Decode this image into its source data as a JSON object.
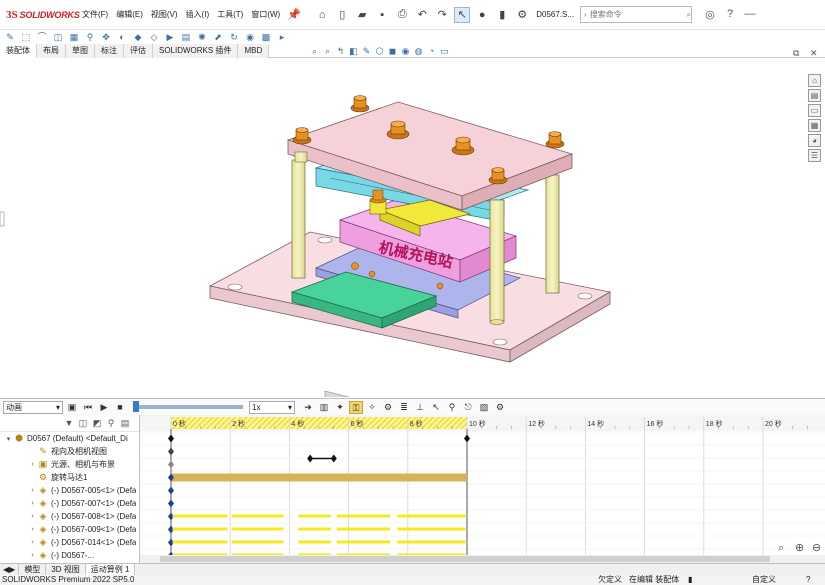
{
  "app": {
    "logo_ds": "3S",
    "logo_name": "SOLIDWORKS",
    "document": "D0567.S...",
    "search_placeholder": "搜索命令"
  },
  "menu": [
    "文件(F)",
    "编辑(E)",
    "视图(V)",
    "插入(I)",
    "工具(T)",
    "窗口(W)"
  ],
  "command_tabs": [
    "装配体",
    "布局",
    "草图",
    "标注",
    "评估",
    "SOLIDWORKS 插件",
    "MBD"
  ],
  "viewport": {
    "banner_text": "机械充电站",
    "colors": {
      "top_plate": "#f6d2d8",
      "base_plate": "#f8dde2",
      "posts": "#f3efb0",
      "cylinder": "#79d8e6",
      "block_pink": "#ef9fe0",
      "plate_purple": "#aeb5ec",
      "green_pad": "#47d39a",
      "yellow_part": "#f2e83a",
      "bolt": "#e59223"
    }
  },
  "motion": {
    "study_type": "动画",
    "speed": "1x",
    "time_labels": [
      "0 秒",
      "2 秒",
      "4 秒",
      "6 秒",
      "8 秒",
      "10 秒",
      "12 秒",
      "14 秒",
      "16 秒",
      "18 秒",
      "20 秒"
    ],
    "tree": [
      {
        "arrow": "▾",
        "indent": 0,
        "icon": "assembly-icon",
        "glyph": "⬢",
        "label": "D0567 (Default) <Default_Di"
      },
      {
        "arrow": "",
        "indent": 1,
        "icon": "camera-icon",
        "glyph": "✎",
        "label": "视向及相机视图"
      },
      {
        "arrow": "›",
        "indent": 1,
        "icon": "light-icon",
        "glyph": "▣",
        "label": "光源、相机与布景"
      },
      {
        "arrow": "",
        "indent": 1,
        "icon": "motor-icon",
        "glyph": "⚙",
        "label": "旋转马达1"
      },
      {
        "arrow": "›",
        "indent": 1,
        "icon": "part-icon",
        "glyph": "◈",
        "label": "(-) D0567-005<1> (Defa"
      },
      {
        "arrow": "›",
        "indent": 1,
        "icon": "part-icon",
        "glyph": "◈",
        "label": "(-) D0567-007<1> (Defa"
      },
      {
        "arrow": "›",
        "indent": 1,
        "icon": "part-icon",
        "glyph": "◈",
        "label": "(-) D0567-008<1> (Defa"
      },
      {
        "arrow": "›",
        "indent": 1,
        "icon": "part-icon",
        "glyph": "◈",
        "label": "(-) D0567-009<1> (Defa"
      },
      {
        "arrow": "›",
        "indent": 1,
        "icon": "part-icon",
        "glyph": "◈",
        "label": "(-) D0567-014<1> (Defa"
      },
      {
        "arrow": "›",
        "indent": 1,
        "icon": "part-icon",
        "glyph": "◈",
        "label": "(-) D0567-..."
      }
    ]
  },
  "bottom_tabs": [
    "模型",
    "3D 视图",
    "运动算例 1"
  ],
  "status": {
    "product": "SOLIDWORKS Premium 2022 SP5.0",
    "undefined": "欠定义",
    "editing": "在编辑 装配体",
    "custom": "自定义"
  }
}
